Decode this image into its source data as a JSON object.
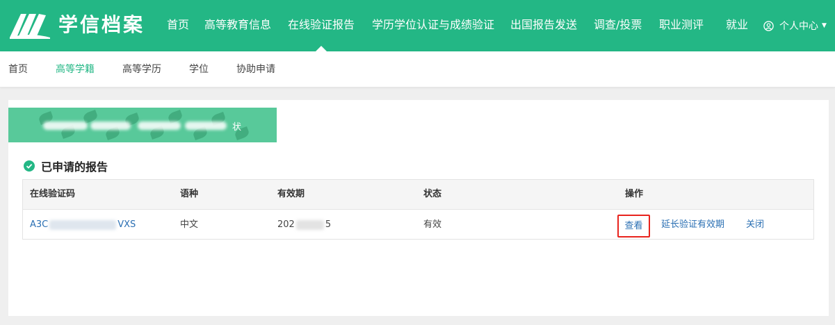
{
  "header": {
    "logo_text": "学信档案",
    "nav": [
      {
        "label": "首页"
      },
      {
        "label": "高等教育信息"
      },
      {
        "label": "在线验证报告"
      },
      {
        "label": "学历学位认证与成绩验证"
      },
      {
        "label": "出国报告发送"
      },
      {
        "label": "调查/投票"
      },
      {
        "label": "职业测评"
      },
      {
        "label": "就业"
      }
    ],
    "active_nav": "在线验证报告",
    "user_menu_label": "个人中心"
  },
  "subnav": {
    "items": [
      {
        "label": "首页"
      },
      {
        "label": "高等学籍"
      },
      {
        "label": "高等学历"
      },
      {
        "label": "学位"
      },
      {
        "label": "协助申请"
      }
    ],
    "active": "高等学籍"
  },
  "banner": {
    "visible_tail": "状"
  },
  "section": {
    "title": "已申请的报告"
  },
  "table": {
    "columns": [
      "在线验证码",
      "语种",
      "有效期",
      "状态",
      "操作"
    ],
    "rows": [
      {
        "code_prefix": "A3C",
        "code_suffix": "VXS",
        "language": "中文",
        "validity_prefix": "202",
        "validity_suffix": "5",
        "status": "有效",
        "actions": {
          "view": "查看",
          "extend": "延长验证有效期",
          "close": "关闭"
        }
      }
    ]
  },
  "colors": {
    "brand_green": "#23b785",
    "link_blue": "#2a6fb3",
    "highlight_red": "#e8231d"
  }
}
